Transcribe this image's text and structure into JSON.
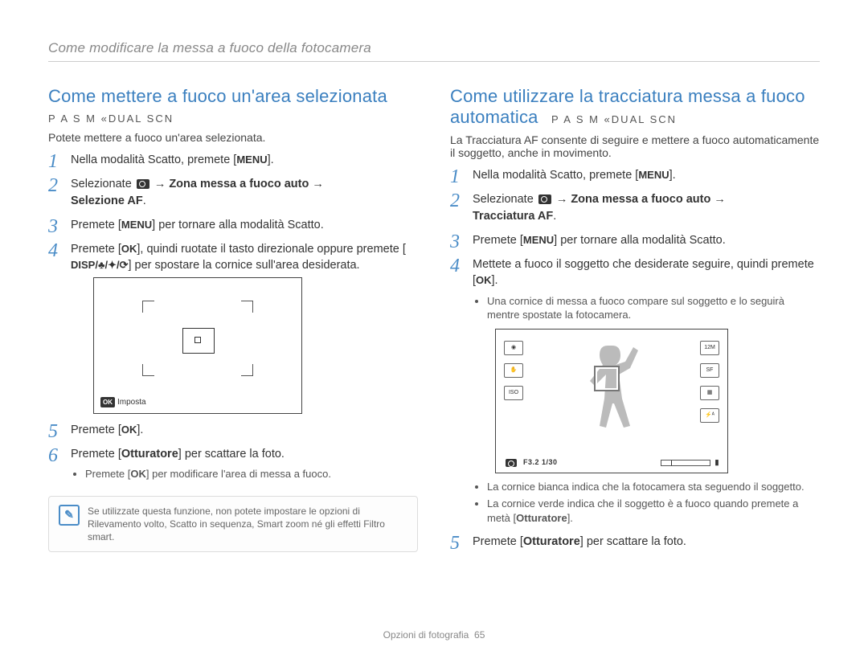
{
  "header": "Come modificare la messa a fuoco della fotocamera",
  "left": {
    "title": "Come mettere a fuoco un'area selezionata",
    "modes": "P A S M «DUAL SCN",
    "intro": "Potete mettere a fuoco un'area selezionata.",
    "steps": {
      "s1_a": "Nella modalità Scatto, premete [",
      "s1_key": "MENU",
      "s1_b": "].",
      "s2_a": "Selezionate ",
      "s2_b": "Zona messa a fuoco auto",
      "s2_c": "Selezione AF",
      "s3_a": "Premete [",
      "s3_key": "MENU",
      "s3_b": "] per tornare alla modalità Scatto.",
      "s4_a": "Premete [",
      "s4_key": "OK",
      "s4_b": "], quindi ruotate il tasto direzionale oppure premete [",
      "s4_keys": "DISP/♣/✦/⟳",
      "s4_c": "] per spostare la cornice sull'area desiderata.",
      "screen_label": "Imposta",
      "s5_a": "Premete [",
      "s5_key": "OK",
      "s5_b": "].",
      "s6_a": "Premete [",
      "s6_key": "Otturatore",
      "s6_b": "] per scattare la foto.",
      "s6_sub_a": "Premete [",
      "s6_sub_key": "OK",
      "s6_sub_b": "] per modificare l'area di messa a fuoco."
    },
    "note": "Se utilizzate questa funzione, non potete impostare le opzioni di Rilevamento volto, Scatto in sequenza, Smart zoom né gli effetti Filtro smart."
  },
  "right": {
    "title_a": "Come utilizzare la tracciatura messa a fuoco automatica",
    "modes": "P A S M «DUAL SCN",
    "intro": "La Tracciatura AF consente di seguire e mettere a fuoco automaticamente il soggetto, anche in movimento.",
    "steps": {
      "s1_a": "Nella modalità Scatto, premete [",
      "s1_key": "MENU",
      "s1_b": "].",
      "s2_a": "Selezionate ",
      "s2_b": "Zona messa a fuoco auto",
      "s2_c": "Tracciatura AF",
      "s3_a": "Premete [",
      "s3_key": "MENU",
      "s3_b": "] per tornare alla modalità Scatto.",
      "s4_a": "Mettete a fuoco il soggetto che desiderate seguire, quindi premete [",
      "s4_key": "OK",
      "s4_b": "].",
      "s4_sub": "Una cornice di messa a fuoco compare sul soggetto e lo seguirà mentre spostate la fotocamera.",
      "osd_bottom": "F3.2  1/30",
      "below1": "La cornice bianca indica che la fotocamera sta seguendo il soggetto.",
      "below2_a": "La cornice verde indica che il soggetto è a fuoco quando premete a metà [",
      "below2_key": "Otturatore",
      "below2_b": "].",
      "s5_a": "Premete [",
      "s5_key": "Otturatore",
      "s5_b": "] per scattare la foto."
    }
  },
  "footer_a": "Opzioni di fotografia",
  "footer_b": "65"
}
